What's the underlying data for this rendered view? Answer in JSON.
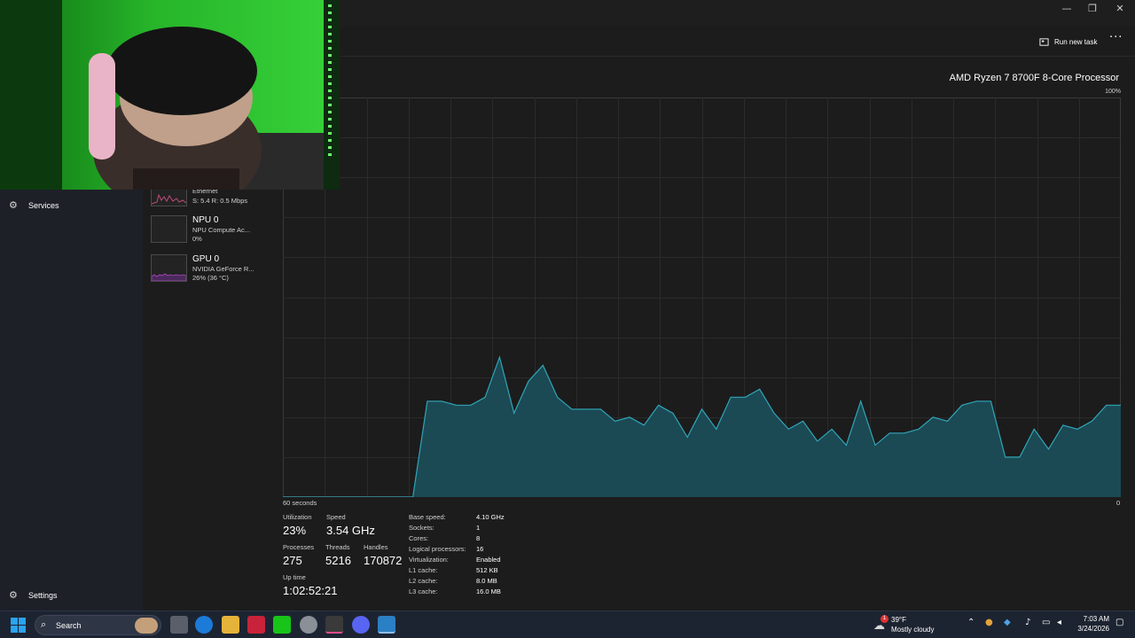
{
  "window": {
    "minimize_icon": "minimize-icon",
    "maximize_icon": "restore-icon",
    "close_icon": "close-icon",
    "min_glyph": "—",
    "max_glyph": "❐",
    "close_glyph": "✕"
  },
  "toolbar": {
    "run_new_task_label": "Run new task",
    "more_glyph": "···"
  },
  "nav": {
    "services_label": "Services",
    "settings_label": "Settings"
  },
  "devices": [
    {
      "name": "Ethernet",
      "sub": "S: 5.4 R: 0.5 Mbps"
    },
    {
      "name": "NPU 0",
      "sub1": "NPU Compute Ac...",
      "sub2": "0%"
    },
    {
      "name": "GPU 0",
      "sub1": "NVIDIA GeForce R...",
      "sub2": "26% (36 °C)"
    }
  ],
  "cpu": {
    "processor_name": "AMD Ryzen 7 8700F 8-Core Processor",
    "max_label": "100%",
    "time_label": "60 seconds",
    "min_label": "0",
    "graph_color": "#30a5b8",
    "graph_fill": "#1b4a54",
    "history_percent": [
      0,
      0,
      0,
      0,
      0,
      0,
      0,
      0,
      0,
      0,
      24,
      24,
      23,
      23,
      25,
      35,
      21,
      29,
      33,
      25,
      22,
      22,
      22,
      19,
      20,
      18,
      23,
      21,
      15,
      22,
      17,
      25,
      25,
      27,
      21,
      17,
      19,
      14,
      17,
      13,
      24,
      13,
      16,
      16,
      17,
      20,
      19,
      23,
      24,
      24,
      10,
      10,
      17,
      12,
      18,
      17,
      19,
      23,
      23
    ]
  },
  "stats": {
    "utilization_label": "Utilization",
    "utilization_value": "23%",
    "speed_label": "Speed",
    "speed_value": "3.54 GHz",
    "processes_label": "Processes",
    "processes_value": "275",
    "threads_label": "Threads",
    "threads_value": "5216",
    "handles_label": "Handles",
    "handles_value": "170872",
    "uptime_label": "Up time",
    "uptime_value": "1:02:52:21"
  },
  "specs": [
    {
      "key": "Base speed:",
      "value": "4.10 GHz"
    },
    {
      "key": "Sockets:",
      "value": "1"
    },
    {
      "key": "Cores:",
      "value": "8"
    },
    {
      "key": "Logical processors:",
      "value": "16"
    },
    {
      "key": "Virtualization:",
      "value": "Enabled"
    },
    {
      "key": "L1 cache:",
      "value": "512 KB"
    },
    {
      "key": "L2 cache:",
      "value": "8.0 MB"
    },
    {
      "key": "L3 cache:",
      "value": "16.0 MB"
    }
  ],
  "taskbar": {
    "search_label": "Search",
    "weather_temp": "39°F",
    "weather_cond": "Mostly cloudy",
    "weather_badge": "1",
    "time": "7:03 AM",
    "date": "3/24/2026"
  }
}
